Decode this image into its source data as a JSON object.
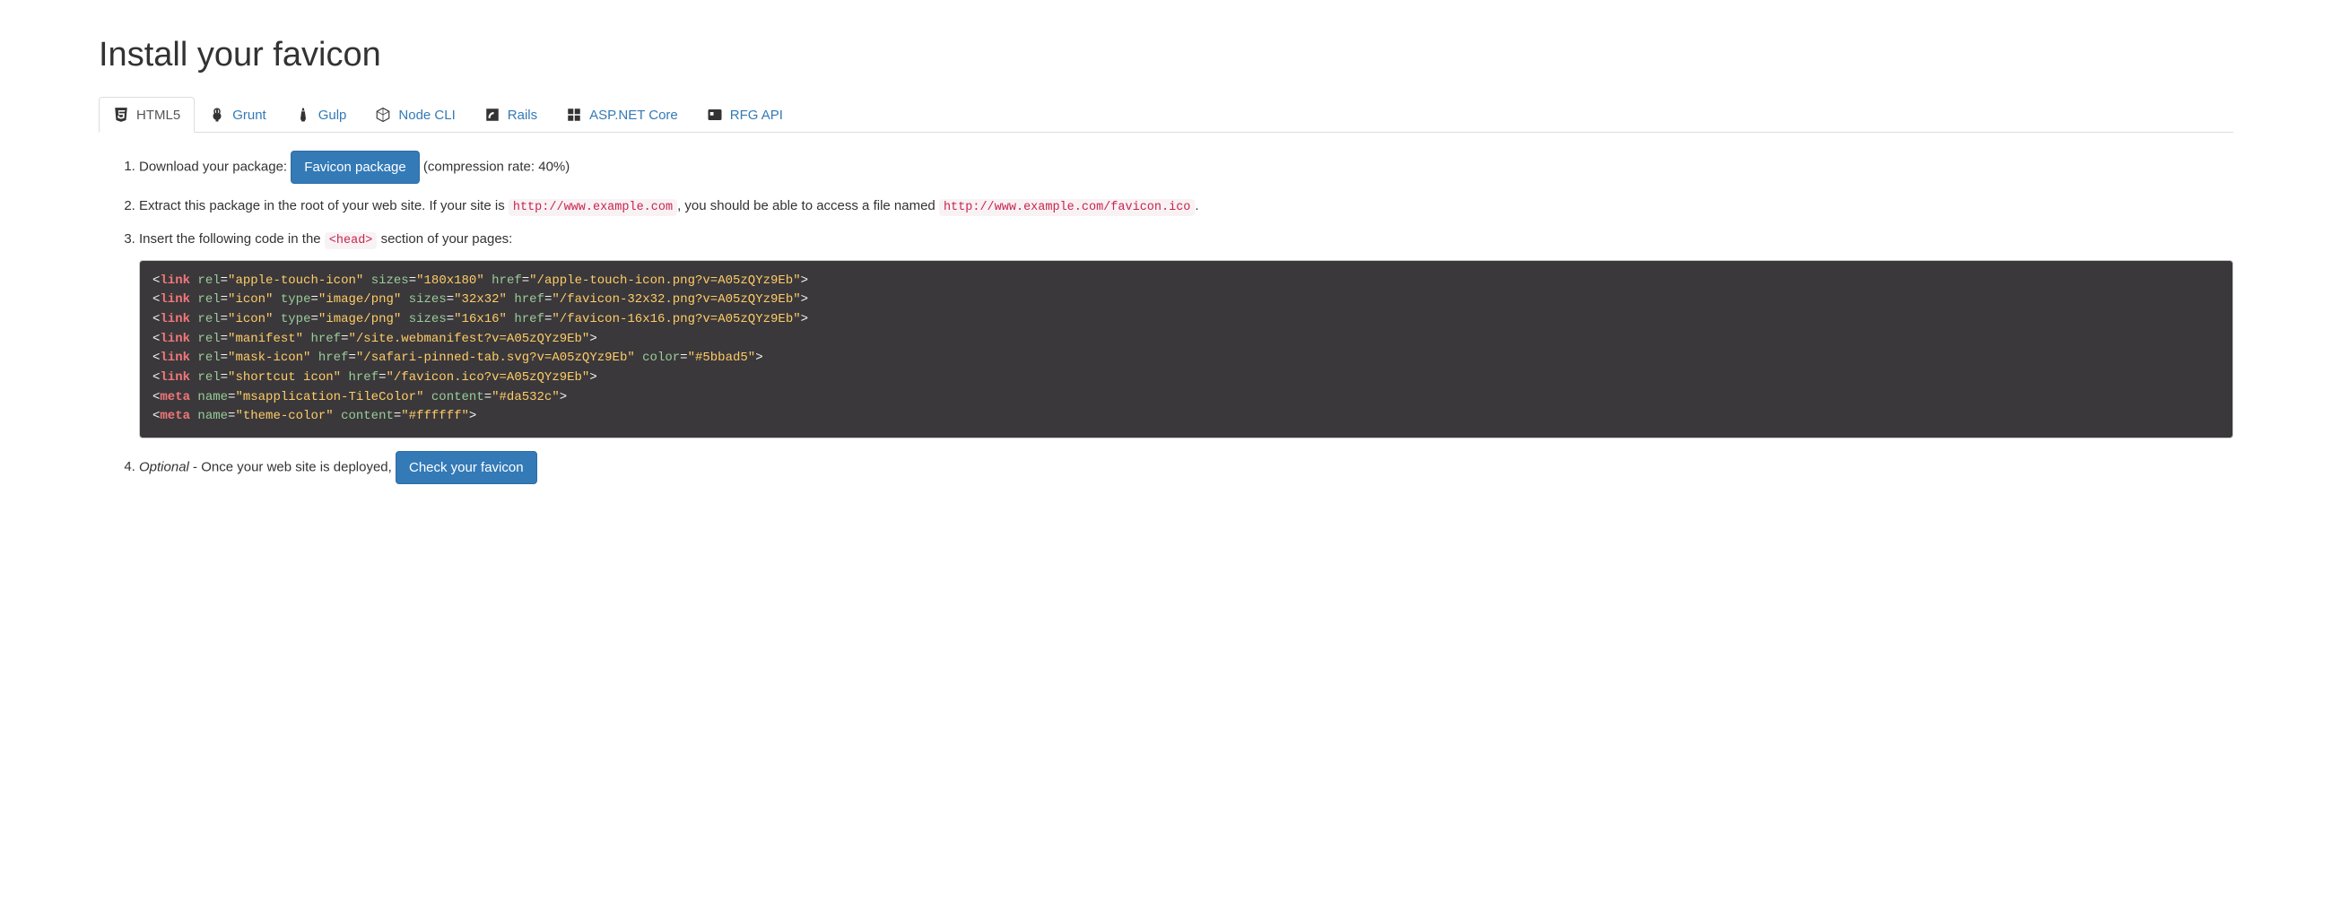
{
  "title": "Install your favicon",
  "tabs": [
    {
      "label": "HTML5",
      "icon": "html5-icon"
    },
    {
      "label": "Grunt",
      "icon": "grunt-icon"
    },
    {
      "label": "Gulp",
      "icon": "gulp-icon"
    },
    {
      "label": "Node CLI",
      "icon": "nodejs-icon"
    },
    {
      "label": "Rails",
      "icon": "rails-icon"
    },
    {
      "label": "ASP.NET Core",
      "icon": "dotnet-icon"
    },
    {
      "label": "RFG API",
      "icon": "rfg-icon"
    }
  ],
  "steps": {
    "step1": {
      "prefix": "Download your package:",
      "button": "Favicon package",
      "suffix": "(compression rate: 40%)"
    },
    "step2": {
      "part1": "Extract this package in the root of your web site. If your site is ",
      "code1": "http://www.example.com",
      "part2": ", you should be able to access a file named ",
      "code2": "http://www.example.com/favicon.ico",
      "part3": "."
    },
    "step3": {
      "part1": "Insert the following code in the ",
      "code1": "<head>",
      "part2": " section of your pages:",
      "code_lines": [
        {
          "tag": "link",
          "attrs": [
            [
              "rel",
              "apple-touch-icon"
            ],
            [
              "sizes",
              "180x180"
            ],
            [
              "href",
              "/apple-touch-icon.png?v=A05zQYz9Eb"
            ]
          ]
        },
        {
          "tag": "link",
          "attrs": [
            [
              "rel",
              "icon"
            ],
            [
              "type",
              "image/png"
            ],
            [
              "sizes",
              "32x32"
            ],
            [
              "href",
              "/favicon-32x32.png?v=A05zQYz9Eb"
            ]
          ]
        },
        {
          "tag": "link",
          "attrs": [
            [
              "rel",
              "icon"
            ],
            [
              "type",
              "image/png"
            ],
            [
              "sizes",
              "16x16"
            ],
            [
              "href",
              "/favicon-16x16.png?v=A05zQYz9Eb"
            ]
          ]
        },
        {
          "tag": "link",
          "attrs": [
            [
              "rel",
              "manifest"
            ],
            [
              "href",
              "/site.webmanifest?v=A05zQYz9Eb"
            ]
          ]
        },
        {
          "tag": "link",
          "attrs": [
            [
              "rel",
              "mask-icon"
            ],
            [
              "href",
              "/safari-pinned-tab.svg?v=A05zQYz9Eb"
            ],
            [
              "color",
              "#5bbad5"
            ]
          ]
        },
        {
          "tag": "link",
          "attrs": [
            [
              "rel",
              "shortcut icon"
            ],
            [
              "href",
              "/favicon.ico?v=A05zQYz9Eb"
            ]
          ]
        },
        {
          "tag": "meta",
          "attrs": [
            [
              "name",
              "msapplication-TileColor"
            ],
            [
              "content",
              "#da532c"
            ]
          ]
        },
        {
          "tag": "meta",
          "attrs": [
            [
              "name",
              "theme-color"
            ],
            [
              "content",
              "#ffffff"
            ]
          ]
        }
      ]
    },
    "step4": {
      "optional": "Optional",
      "text": " - Once your web site is deployed, ",
      "button": "Check your favicon"
    }
  }
}
